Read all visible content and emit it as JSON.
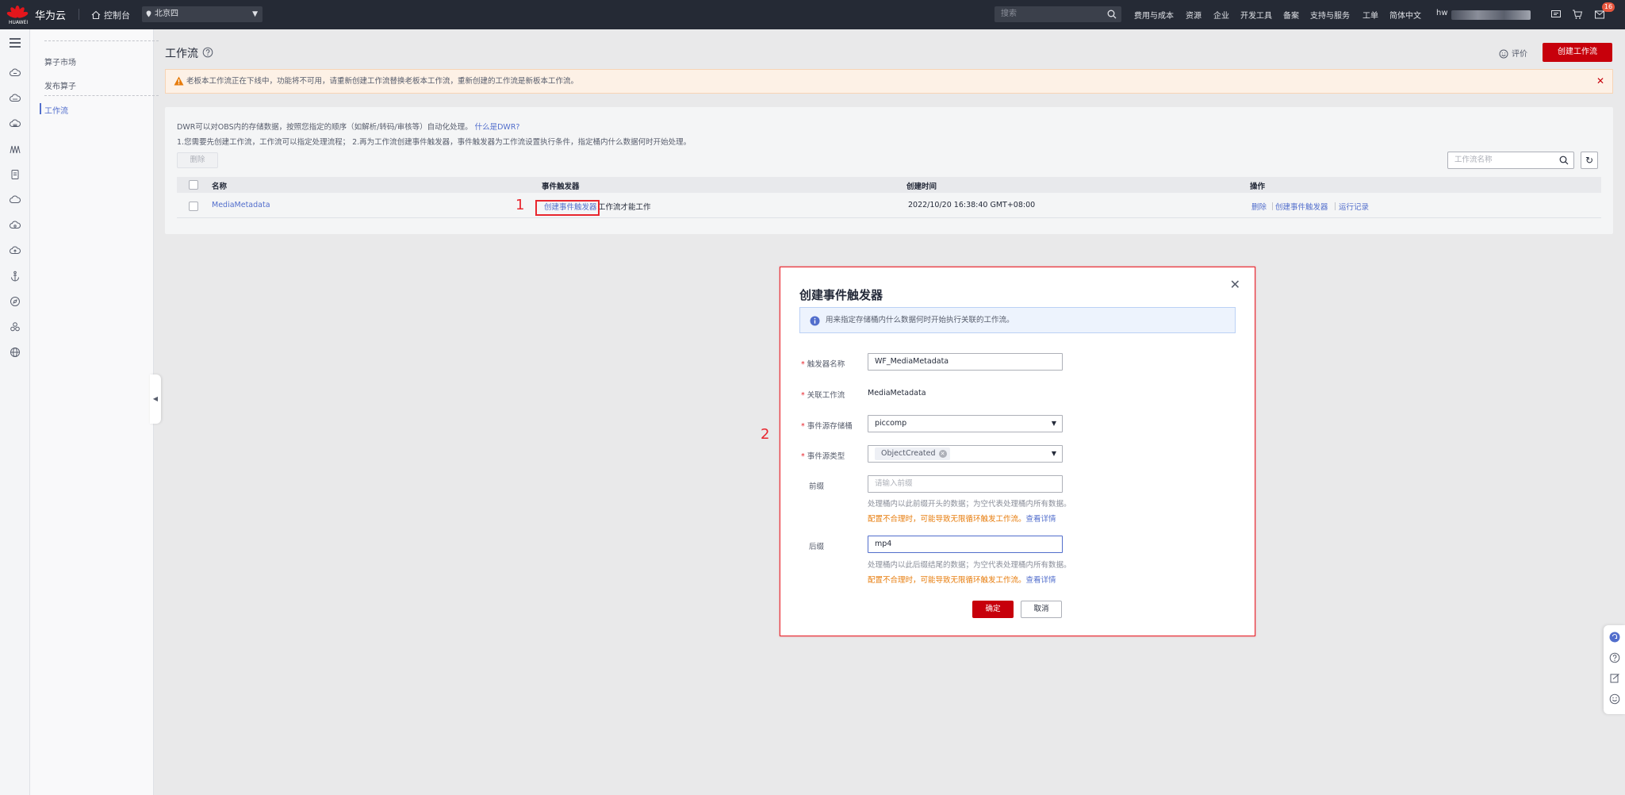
{
  "topbar": {
    "brand": "华为云",
    "logo_text": "HUAWEI",
    "console": "控制台",
    "region": "北京四",
    "search_placeholder": "搜索",
    "nav": [
      "费用与成本",
      "资源",
      "企业",
      "开发工具",
      "备案",
      "支持与服务",
      "工单",
      "简体中文"
    ],
    "user": "hw",
    "notification_count": "16"
  },
  "sidenav": {
    "items": [
      {
        "label": "算子市场"
      },
      {
        "label": "发布算子"
      },
      {
        "label": "工作流"
      }
    ]
  },
  "page": {
    "title": "工作流",
    "rate_label": "评价",
    "create_button": "创建工作流"
  },
  "warning": {
    "text": "老板本工作流正在下线中，功能将不可用，请重新创建工作流替换老板本工作流，重新创建的工作流是新板本工作流。"
  },
  "card": {
    "desc1": "DWR可以对OBS内的存储数据，按照您指定的顺序（如解析/转码/审核等）自动化处理。",
    "desc1_link": "什么是DWR?",
    "desc2": "1.您需要先创建工作流，工作流可以指定处理流程； 2.再为工作流创建事件触发器，事件触发器为工作流设置执行条件，指定桶内什么数据何时开始处理。",
    "delete_button": "删除",
    "filter_placeholder": "工作流名称",
    "columns": [
      "名称",
      "事件触发器",
      "创建时间",
      "操作"
    ],
    "rows": [
      {
        "name": "MediaMetadata",
        "trigger_link": "创建事件触发器",
        "trigger_suffix": "工作流才能工作",
        "created": "2022/10/20 16:38:40 GMT+08:00",
        "actions": [
          "删除",
          "创建事件触发器",
          "运行记录"
        ]
      }
    ]
  },
  "annotations": {
    "step1": "1",
    "step2": "2"
  },
  "dialog": {
    "title": "创建事件触发器",
    "info": "用来指定存储桶内什么数据何时开始执行关联的工作流。",
    "fields": {
      "trigger_name": {
        "label": "触发器名称",
        "value": "WF_MediaMetadata"
      },
      "workflow": {
        "label": "关联工作流",
        "value": "MediaMetadata"
      },
      "bucket": {
        "label": "事件源存储桶",
        "value": "piccomp"
      },
      "event_type": {
        "label": "事件源类型",
        "value": "ObjectCreated"
      },
      "prefix": {
        "label": "前缀",
        "placeholder": "请输入前缀",
        "hint": "处理桶内以此前缀开头的数据；为空代表处理桶内所有数据。",
        "warn": "配置不合理时，可能导致无限循环触发工作流。",
        "warn_link": "查看详情"
      },
      "suffix": {
        "label": "后缀",
        "value": "mp4",
        "hint": "处理桶内以此后缀结尾的数据；为空代表处理桶内所有数据。",
        "warn": "配置不合理时，可能导致无限循环触发工作流。",
        "warn_link": "查看详情"
      }
    },
    "ok": "确定",
    "cancel": "取消"
  },
  "colors": {
    "brand_red": "#c7000b",
    "link_blue": "#526ecc",
    "topbar_bg": "#252a35",
    "annotation_red": "#e8262e"
  }
}
